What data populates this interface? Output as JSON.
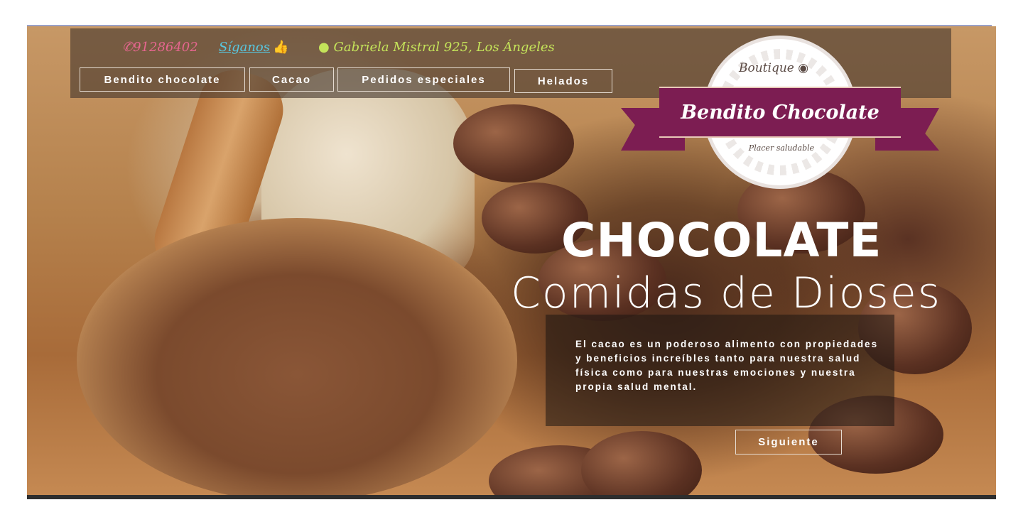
{
  "header": {
    "phone": "91286402",
    "follow_label": "Síganos",
    "address": "Gabriela Mistral 925, Los Ángeles"
  },
  "nav": {
    "items": [
      {
        "label": "Bendito chocolate"
      },
      {
        "label": "Cacao"
      },
      {
        "label": "Pedidos especiales"
      },
      {
        "label": "Helados"
      }
    ]
  },
  "logo": {
    "boutique": "Boutique",
    "name": "Bendito Chocolate",
    "tagline": "Placer saludable"
  },
  "hero": {
    "title": "CHOCOLATE",
    "subtitle": "Comidas de Dioses",
    "description": "El cacao es un poderoso alimento con propiedades y beneficios increíbles tanto para nuestra salud física como para nuestras emociones y nuestra propia salud mental.",
    "next_label": "Siguiente"
  },
  "icons": {
    "phone": "phone-icon",
    "thumb": "thumbs-up-icon",
    "location": "location-pin-icon",
    "coffee": "coffee-bean-icon"
  },
  "colors": {
    "brand": "#7c1d52",
    "phone": "#e5668f",
    "follow": "#58c7e0",
    "address": "#c4e35a"
  }
}
